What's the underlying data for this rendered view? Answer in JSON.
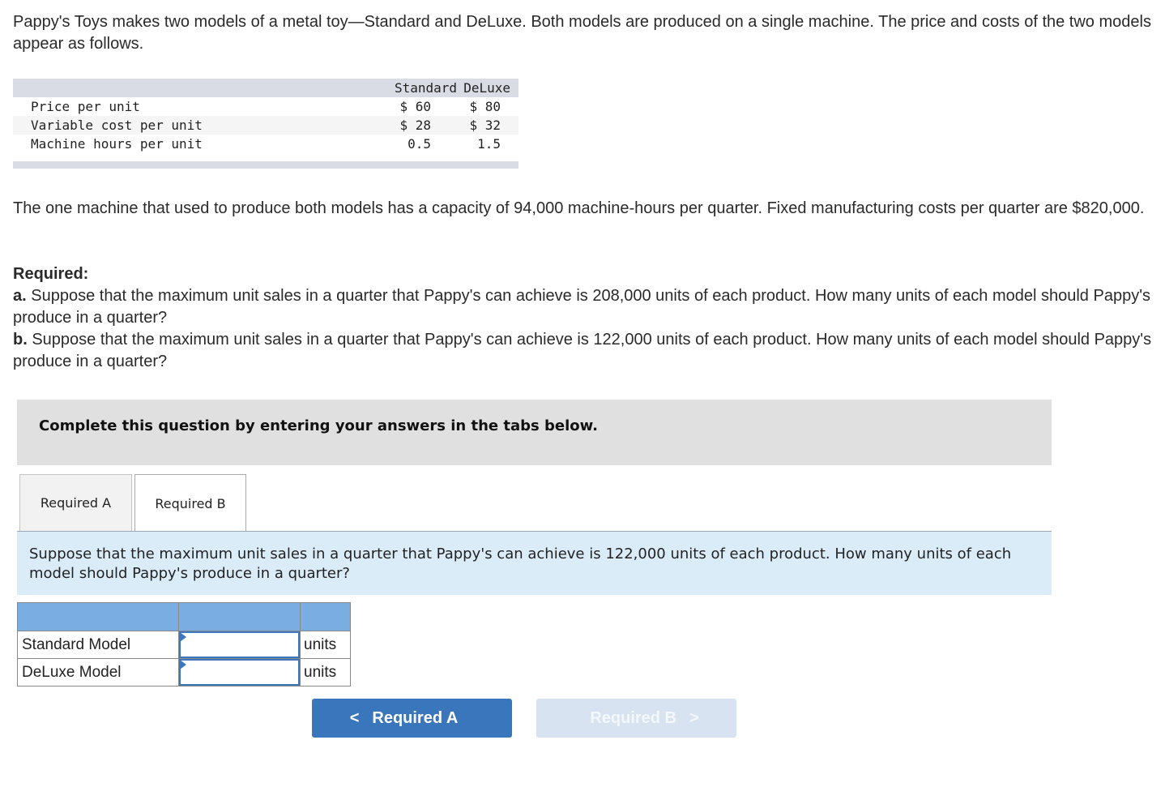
{
  "intro": "Pappy's Toys makes two models of a metal toy—Standard and DeLuxe. Both models are produced on a single machine. The price and costs of the two models appear as follows.",
  "cost_table": {
    "columns": [
      "Standard",
      "DeLuxe"
    ],
    "rows": [
      {
        "label": "Price per unit",
        "standard": "$ 60",
        "deluxe": "$ 80"
      },
      {
        "label": "Variable cost per unit",
        "standard": "$ 28",
        "deluxe": "$ 32"
      },
      {
        "label": "Machine hours per unit",
        "standard": "0.5",
        "deluxe": "1.5"
      }
    ]
  },
  "capacity_text": "The one machine that used to produce both models has a capacity of 94,000 machine-hours per quarter. Fixed manufacturing costs per quarter are $820,000.",
  "required": {
    "heading": "Required:",
    "a_label": "a.",
    "a_text": " Suppose that the maximum unit sales in a quarter that Pappy's can achieve is 208,000 units of each product. How many units of each model should Pappy's produce in a quarter?",
    "b_label": "b.",
    "b_text": " Suppose that the maximum unit sales in a quarter that Pappy's can achieve is 122,000 units of each product. How many units of each model should Pappy's produce in a quarter?"
  },
  "instructions": "Complete this question by entering your answers in the tabs below.",
  "tabs": [
    {
      "label": "Required A",
      "active": false
    },
    {
      "label": "Required B",
      "active": true
    }
  ],
  "question": "Suppose that the maximum unit sales in a quarter that Pappy's can achieve is 122,000 units of each product. How many units of each model should Pappy's produce in a quarter?",
  "answer_table": {
    "rows": [
      {
        "label": "Standard Model",
        "value": "",
        "unit": "units"
      },
      {
        "label": "DeLuxe Model",
        "value": "",
        "unit": "units"
      }
    ]
  },
  "nav": {
    "prev_label": "Required A",
    "prev_icon": "chevron-left-icon",
    "next_label": "Required B",
    "next_icon": "chevron-right-icon",
    "next_disabled": true
  },
  "colors": {
    "primary_button": "#3a76bb",
    "disabled_button": "#d7e3f1",
    "question_bg": "#dbecf9",
    "table_header": "#7aaee3",
    "input_border": "#3b78bf"
  }
}
